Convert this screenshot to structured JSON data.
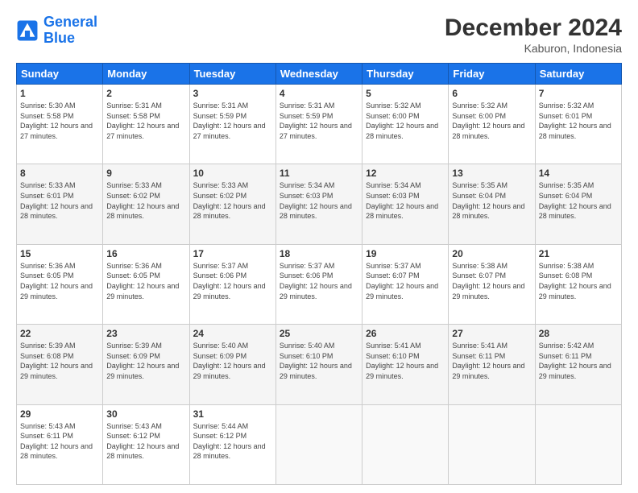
{
  "logo": {
    "line1": "General",
    "line2": "Blue"
  },
  "title": "December 2024",
  "location": "Kaburon, Indonesia",
  "days_header": [
    "Sunday",
    "Monday",
    "Tuesday",
    "Wednesday",
    "Thursday",
    "Friday",
    "Saturday"
  ],
  "weeks": [
    [
      {
        "num": "1",
        "rise": "5:30 AM",
        "set": "5:58 PM",
        "daylight": "12 hours and 27 minutes."
      },
      {
        "num": "2",
        "rise": "5:31 AM",
        "set": "5:58 PM",
        "daylight": "12 hours and 27 minutes."
      },
      {
        "num": "3",
        "rise": "5:31 AM",
        "set": "5:59 PM",
        "daylight": "12 hours and 27 minutes."
      },
      {
        "num": "4",
        "rise": "5:31 AM",
        "set": "5:59 PM",
        "daylight": "12 hours and 27 minutes."
      },
      {
        "num": "5",
        "rise": "5:32 AM",
        "set": "6:00 PM",
        "daylight": "12 hours and 28 minutes."
      },
      {
        "num": "6",
        "rise": "5:32 AM",
        "set": "6:00 PM",
        "daylight": "12 hours and 28 minutes."
      },
      {
        "num": "7",
        "rise": "5:32 AM",
        "set": "6:01 PM",
        "daylight": "12 hours and 28 minutes."
      }
    ],
    [
      {
        "num": "8",
        "rise": "5:33 AM",
        "set": "6:01 PM",
        "daylight": "12 hours and 28 minutes."
      },
      {
        "num": "9",
        "rise": "5:33 AM",
        "set": "6:02 PM",
        "daylight": "12 hours and 28 minutes."
      },
      {
        "num": "10",
        "rise": "5:33 AM",
        "set": "6:02 PM",
        "daylight": "12 hours and 28 minutes."
      },
      {
        "num": "11",
        "rise": "5:34 AM",
        "set": "6:03 PM",
        "daylight": "12 hours and 28 minutes."
      },
      {
        "num": "12",
        "rise": "5:34 AM",
        "set": "6:03 PM",
        "daylight": "12 hours and 28 minutes."
      },
      {
        "num": "13",
        "rise": "5:35 AM",
        "set": "6:04 PM",
        "daylight": "12 hours and 28 minutes."
      },
      {
        "num": "14",
        "rise": "5:35 AM",
        "set": "6:04 PM",
        "daylight": "12 hours and 28 minutes."
      }
    ],
    [
      {
        "num": "15",
        "rise": "5:36 AM",
        "set": "6:05 PM",
        "daylight": "12 hours and 29 minutes."
      },
      {
        "num": "16",
        "rise": "5:36 AM",
        "set": "6:05 PM",
        "daylight": "12 hours and 29 minutes."
      },
      {
        "num": "17",
        "rise": "5:37 AM",
        "set": "6:06 PM",
        "daylight": "12 hours and 29 minutes."
      },
      {
        "num": "18",
        "rise": "5:37 AM",
        "set": "6:06 PM",
        "daylight": "12 hours and 29 minutes."
      },
      {
        "num": "19",
        "rise": "5:37 AM",
        "set": "6:07 PM",
        "daylight": "12 hours and 29 minutes."
      },
      {
        "num": "20",
        "rise": "5:38 AM",
        "set": "6:07 PM",
        "daylight": "12 hours and 29 minutes."
      },
      {
        "num": "21",
        "rise": "5:38 AM",
        "set": "6:08 PM",
        "daylight": "12 hours and 29 minutes."
      }
    ],
    [
      {
        "num": "22",
        "rise": "5:39 AM",
        "set": "6:08 PM",
        "daylight": "12 hours and 29 minutes."
      },
      {
        "num": "23",
        "rise": "5:39 AM",
        "set": "6:09 PM",
        "daylight": "12 hours and 29 minutes."
      },
      {
        "num": "24",
        "rise": "5:40 AM",
        "set": "6:09 PM",
        "daylight": "12 hours and 29 minutes."
      },
      {
        "num": "25",
        "rise": "5:40 AM",
        "set": "6:10 PM",
        "daylight": "12 hours and 29 minutes."
      },
      {
        "num": "26",
        "rise": "5:41 AM",
        "set": "6:10 PM",
        "daylight": "12 hours and 29 minutes."
      },
      {
        "num": "27",
        "rise": "5:41 AM",
        "set": "6:11 PM",
        "daylight": "12 hours and 29 minutes."
      },
      {
        "num": "28",
        "rise": "5:42 AM",
        "set": "6:11 PM",
        "daylight": "12 hours and 29 minutes."
      }
    ],
    [
      {
        "num": "29",
        "rise": "5:43 AM",
        "set": "6:11 PM",
        "daylight": "12 hours and 28 minutes."
      },
      {
        "num": "30",
        "rise": "5:43 AM",
        "set": "6:12 PM",
        "daylight": "12 hours and 28 minutes."
      },
      {
        "num": "31",
        "rise": "5:44 AM",
        "set": "6:12 PM",
        "daylight": "12 hours and 28 minutes."
      },
      null,
      null,
      null,
      null
    ]
  ]
}
